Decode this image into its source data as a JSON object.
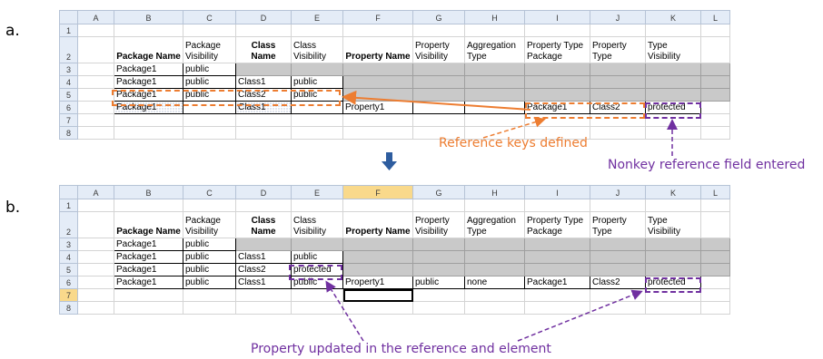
{
  "panels": [
    {
      "label": "a.",
      "columns": [
        "",
        "A",
        "B",
        "C",
        "D",
        "E",
        "F",
        "G",
        "H",
        "I",
        "J",
        "K",
        "L"
      ],
      "selected_column": "",
      "header_row": [
        "",
        "Package Name",
        "Package Visibility",
        "Class Name",
        "Class Visibility",
        "Property Name",
        "Property Visibility",
        "Aggregation Type",
        "Property Type Package",
        "Property Type",
        "Type Visibility",
        ""
      ],
      "rows": [
        {
          "num": "1",
          "cells": [
            "",
            "",
            "",
            "",
            "",
            "",
            "",
            "",
            "",
            "",
            "",
            ""
          ]
        },
        {
          "num": "3",
          "cells": [
            "",
            "Package1",
            "public",
            "",
            "",
            "",
            "",
            "",
            "",
            "",
            "",
            ""
          ]
        },
        {
          "num": "4",
          "cells": [
            "",
            "Package1",
            "public",
            "Class1",
            "public",
            "",
            "",
            "",
            "",
            "",
            "",
            ""
          ]
        },
        {
          "num": "5",
          "cells": [
            "",
            "Package1",
            "public",
            "Class2",
            "public",
            "",
            "",
            "",
            "",
            "",
            "",
            ""
          ]
        },
        {
          "num": "6",
          "cells": [
            "",
            "Package1",
            "",
            "Class1",
            "",
            "Property1",
            "",
            "",
            "Package1",
            "Class2",
            "protected",
            ""
          ]
        },
        {
          "num": "7",
          "cells": [
            "",
            "",
            "",
            "",
            "",
            "",
            "",
            "",
            "",
            "",
            "",
            ""
          ]
        },
        {
          "num": "8",
          "cells": [
            "",
            "",
            "",
            "",
            "",
            "",
            "",
            "",
            "",
            "",
            "",
            ""
          ]
        }
      ]
    },
    {
      "label": "b.",
      "columns": [
        "",
        "A",
        "B",
        "C",
        "D",
        "E",
        "F",
        "G",
        "H",
        "I",
        "J",
        "K",
        "L"
      ],
      "selected_column": "F",
      "header_row": [
        "",
        "Package Name",
        "Package Visibility",
        "Class Name",
        "Class Visibility",
        "Property Name",
        "Property Visibility",
        "Aggregation Type",
        "Property Type Package",
        "Property Type",
        "Type Visibility",
        ""
      ],
      "rows": [
        {
          "num": "1",
          "cells": [
            "",
            "",
            "",
            "",
            "",
            "",
            "",
            "",
            "",
            "",
            "",
            ""
          ]
        },
        {
          "num": "3",
          "cells": [
            "",
            "Package1",
            "public",
            "",
            "",
            "",
            "",
            "",
            "",
            "",
            "",
            ""
          ]
        },
        {
          "num": "4",
          "cells": [
            "",
            "Package1",
            "public",
            "Class1",
            "public",
            "",
            "",
            "",
            "",
            "",
            "",
            ""
          ]
        },
        {
          "num": "5",
          "cells": [
            "",
            "Package1",
            "public",
            "Class2",
            "protected",
            "",
            "",
            "",
            "",
            "",
            "",
            ""
          ]
        },
        {
          "num": "6",
          "cells": [
            "",
            "Package1",
            "public",
            "Class1",
            "public",
            "Property1",
            "public",
            "none",
            "Package1",
            "Class2",
            "protected",
            ""
          ]
        },
        {
          "num": "7",
          "cells": [
            "",
            "",
            "",
            "",
            "",
            "",
            "",
            "",
            "",
            "",
            "",
            ""
          ]
        },
        {
          "num": "8",
          "cells": [
            "",
            "",
            "",
            "",
            "",
            "",
            "",
            "",
            "",
            "",
            "",
            ""
          ]
        }
      ]
    }
  ],
  "annotations": {
    "reference_keys": "Reference  keys defined",
    "nonkey_field": "Nonkey reference  field entered",
    "property_updated": "Property updated in the reference and element"
  },
  "colors": {
    "orange": "#ed7d31",
    "purple": "#7030a0",
    "green": "#1f9e39",
    "arrow_blue": "#2e5d9f"
  }
}
